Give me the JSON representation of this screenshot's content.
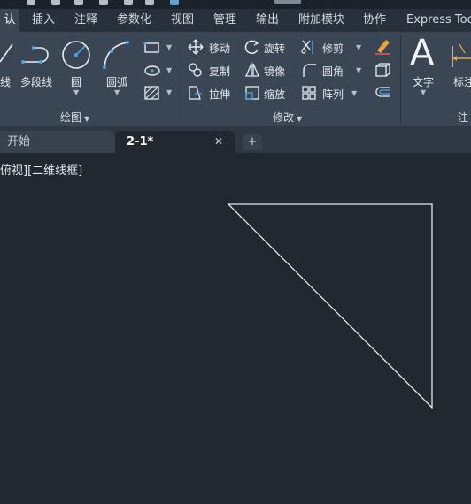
{
  "menu": {
    "tabs": [
      {
        "label": "认",
        "active": true
      },
      {
        "label": "插入"
      },
      {
        "label": "注释"
      },
      {
        "label": "参数化"
      },
      {
        "label": "视图"
      },
      {
        "label": "管理"
      },
      {
        "label": "输出"
      },
      {
        "label": "附加模块"
      },
      {
        "label": "协作"
      },
      {
        "label": "Express Too"
      }
    ]
  },
  "ribbon": {
    "draw_panel": {
      "title": "绘图",
      "line_label": "线",
      "polyline_label": "多段线",
      "circle_label": "圆",
      "arc_label": "圆弧"
    },
    "modify_panel": {
      "title": "修改",
      "move_label": "移动",
      "rotate_label": "旋转",
      "trim_label": "修剪",
      "copy_label": "复制",
      "mirror_label": "镜像",
      "fillet_label": "圆角",
      "stretch_label": "拉伸",
      "scale_label": "缩放",
      "array_label": "阵列"
    },
    "annotation_panel": {
      "text_label": "文字",
      "dim_label": "标注",
      "title": "注"
    }
  },
  "doc_tabs": {
    "start_label": "开始",
    "drawing_label": "2-1*",
    "close_symbol": "✕",
    "add_symbol": "+"
  },
  "viewport": {
    "label": "俯视][二维线框]"
  },
  "colors": {
    "ribbon_bg": "#3b4654",
    "canvas_bg": "#212830",
    "accent_blue": "#4aa3e6",
    "line_color": "#e6e6e6"
  }
}
